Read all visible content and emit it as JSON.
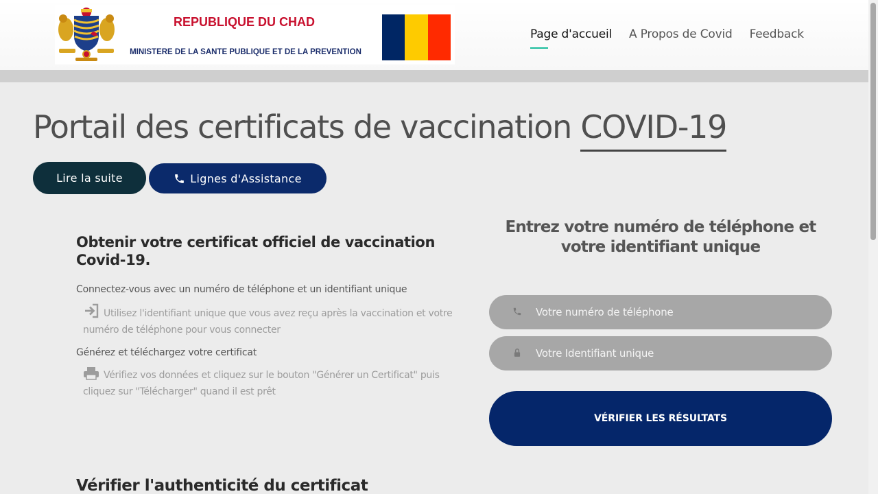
{
  "header": {
    "republic": "REPUBLIQUE DU CHAD",
    "ministry": "MINISTERE DE LA SANTE PUBLIQUE ET DE LA PREVENTION",
    "emblem_icon": "coat-of-arms-icon",
    "flag_colors": [
      "#002664",
      "#fecb00",
      "#ff2a00"
    ]
  },
  "nav": {
    "items": [
      {
        "label": "Page d'accueil",
        "active": true
      },
      {
        "label": "A Propos de Covid",
        "active": false
      },
      {
        "label": "Feedback",
        "active": false
      }
    ],
    "active_underline_color": "#1abc9c"
  },
  "hero": {
    "title_prefix": "Portail des certificats de vaccination",
    "title_highlight": "COVID-19",
    "read_more": "Lire la suite",
    "helplines": "Lignes d'Assistance",
    "helplines_icon": "phone-icon"
  },
  "info": {
    "title": "Obtenir votre certificat officiel de vaccination Covid-19.",
    "step1_title": "Connectez-vous avec un numéro de téléphone et un identifiant unique",
    "step1_icon": "sign-in-icon",
    "step1_desc": "Utilisez l'identifiant unique que vous avez reçu après la vaccination et votre numéro de téléphone pour vous connecter",
    "step2_title": "Générez et téléchargez votre certificat",
    "step2_icon": "printer-icon",
    "step2_desc": "Vérifiez vos données et cliquez sur le bouton \"Générer un Certificat\" puis cliquez sur \"Télécharger\" quand il est prêt",
    "verify_title": "Vérifier l'authenticité du certificat"
  },
  "form": {
    "title": "Entrez votre numéro de téléphone et votre identifiant unique",
    "phone_placeholder": "Votre numéro de téléphone",
    "phone_icon": "phone-icon",
    "id_placeholder": "Votre Identifiant unique",
    "id_icon": "lock-icon",
    "submit": "VÉRIFIER LES RÉSULTATS"
  },
  "colors": {
    "brand_dark": "#0e2f3b",
    "brand_blue": "#0b2a6b",
    "submit_blue": "#05266a"
  }
}
